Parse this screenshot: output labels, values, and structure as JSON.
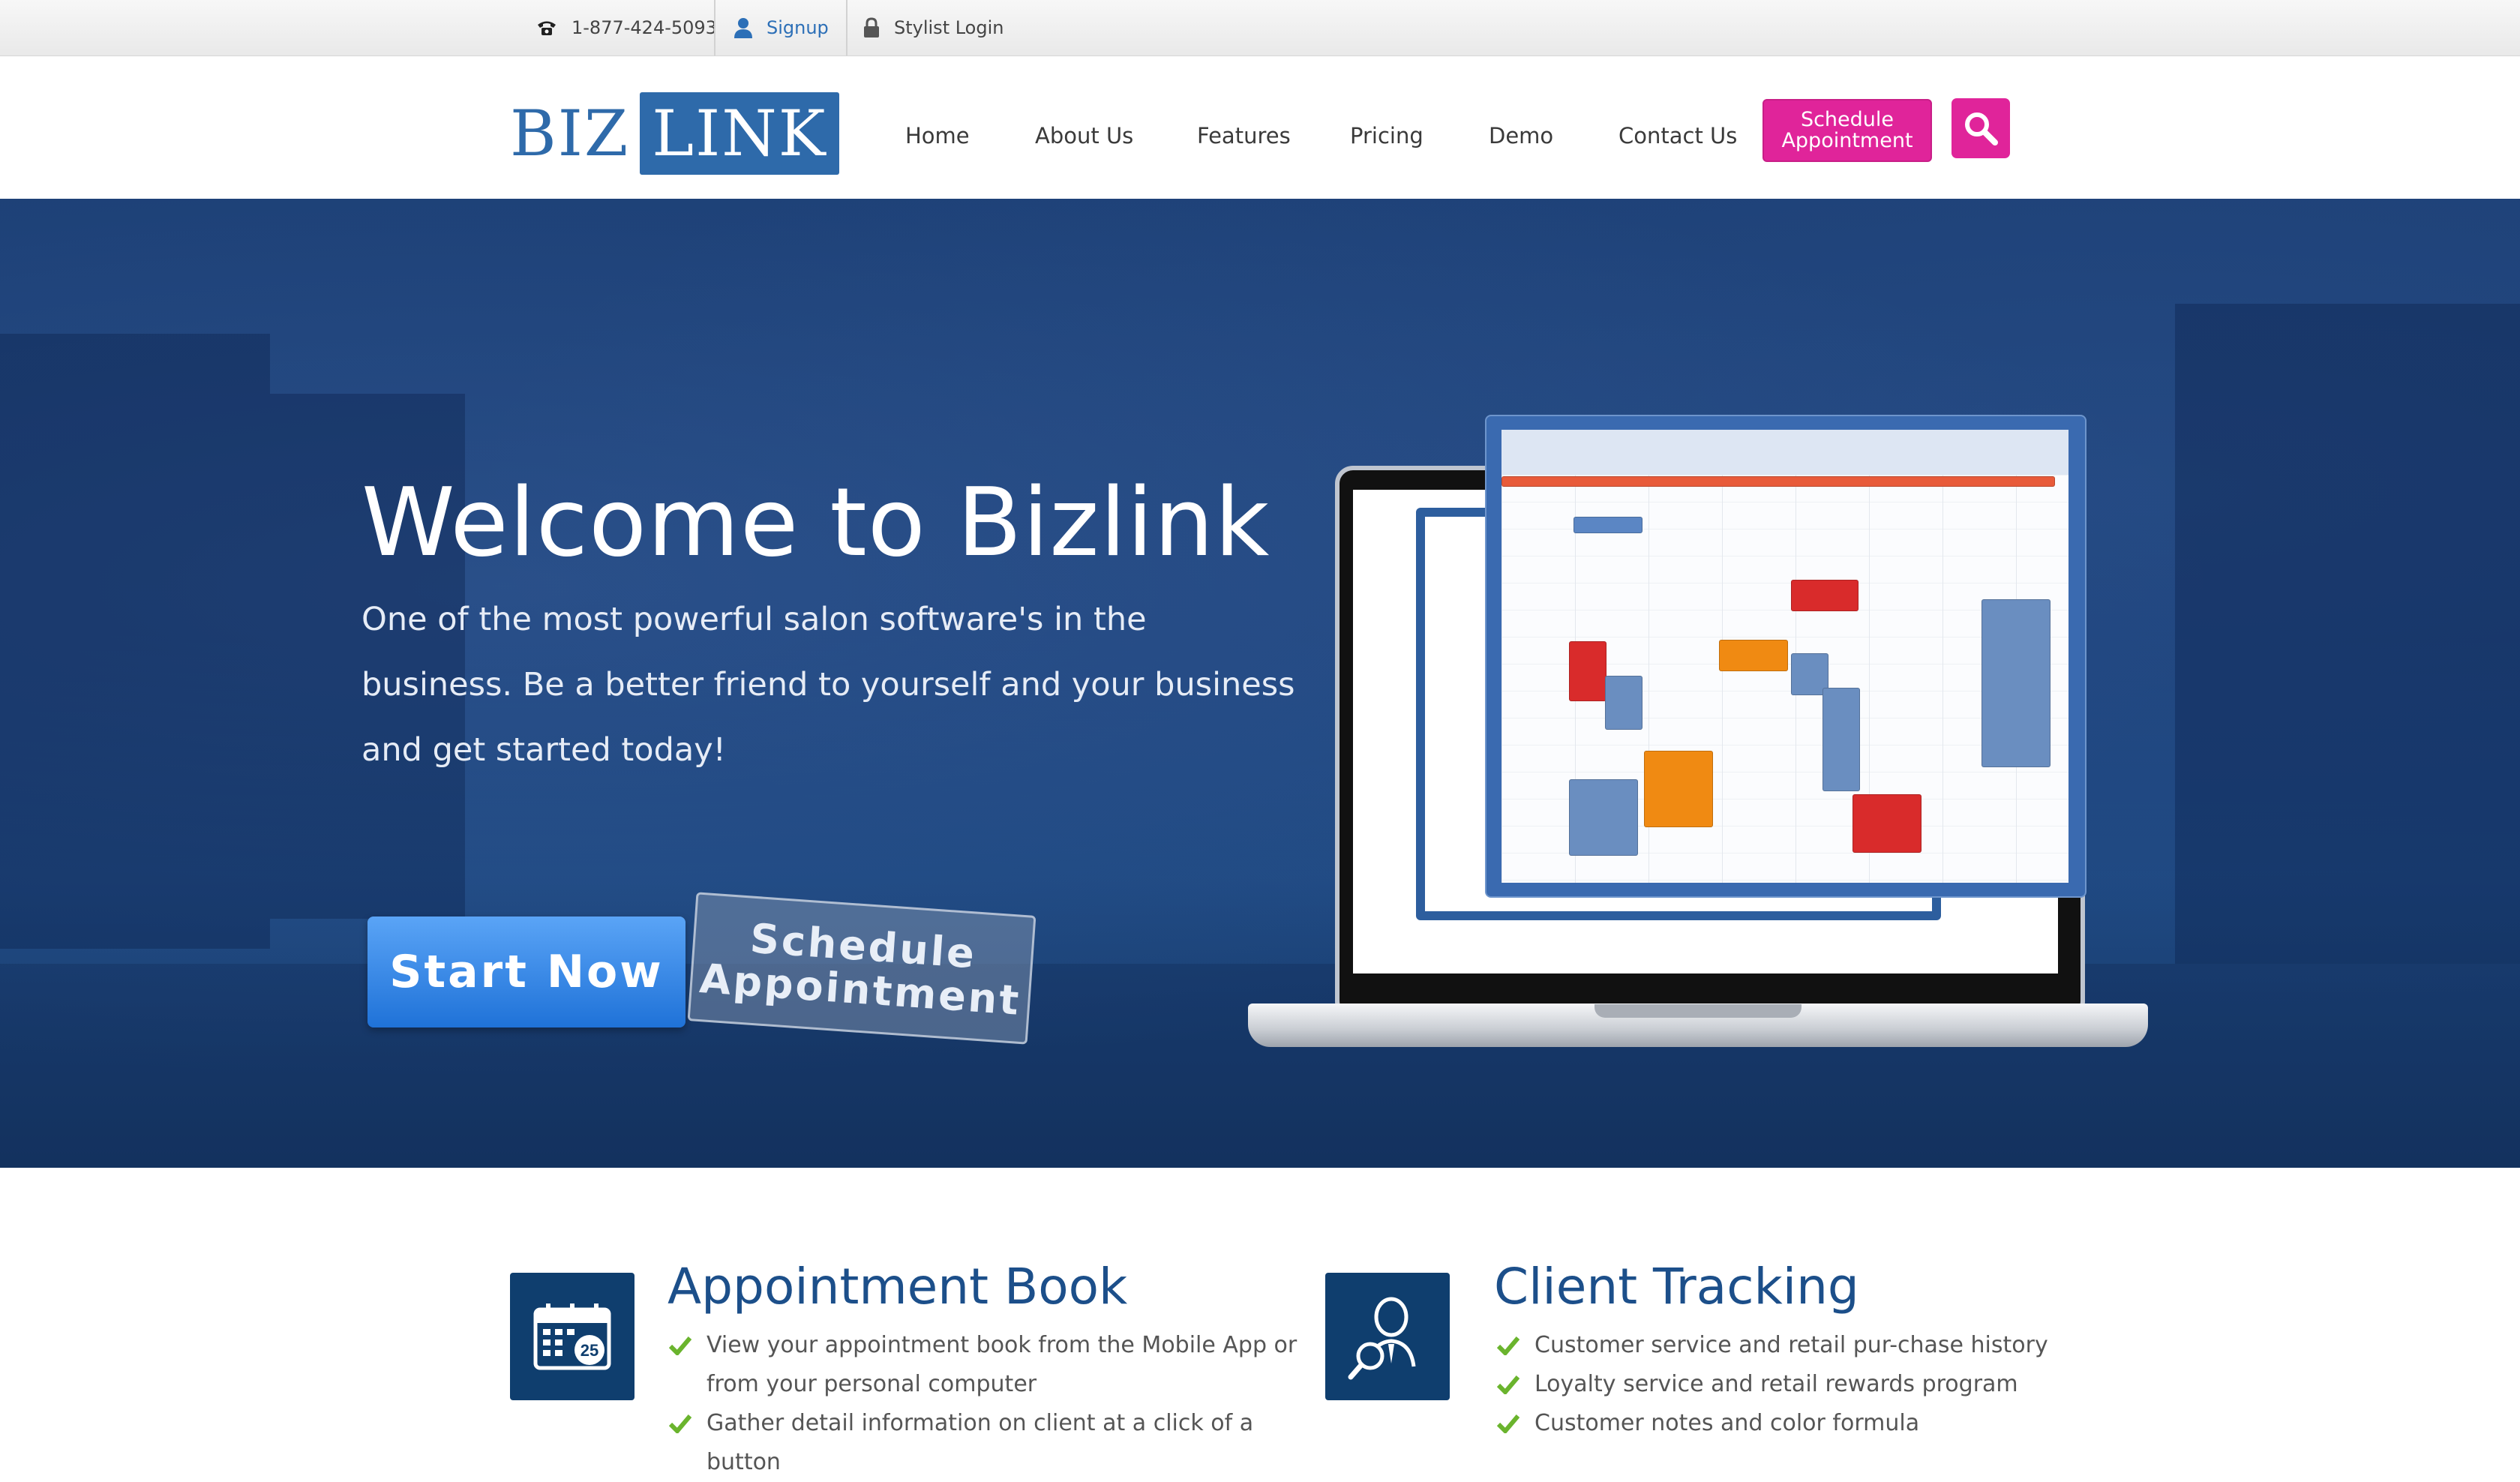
{
  "topbar": {
    "phone": "1-877-424-5093",
    "signup": "Signup",
    "stylist_login": "Stylist Login"
  },
  "logo": {
    "part1": "BIZ",
    "part2": "LINK"
  },
  "nav": {
    "items": [
      "Home",
      "About Us",
      "Features",
      "Pricing",
      "Demo",
      "Contact Us"
    ],
    "schedule_button": "Schedule Appointment"
  },
  "hero": {
    "title": "Welcome to Bizlink",
    "subtitle": "One of the most powerful salon software's in the business. Be a better friend to yourself and your business and get started today!",
    "start_button": "Start Now",
    "schedule_button": "Schedule Appointment"
  },
  "features": [
    {
      "title": "Appointment Book",
      "icon": "calendar-icon",
      "items": [
        "View your appointment book from the Mobile App or from your personal computer",
        "Gather detail information on client at a click of a button"
      ]
    },
    {
      "title": "Client Tracking",
      "icon": "client-search-icon",
      "items": [
        "Customer service and retail pur-chase history",
        "Loyalty service and retail rewards program",
        "Customer notes and color formula"
      ]
    }
  ],
  "colors": {
    "brand_blue": "#2e6aaa",
    "accent_pink": "#e0249a",
    "hero_blue": "#1b3e74",
    "feature_navy": "#0f3e6e",
    "check_green": "#6ab42d"
  }
}
